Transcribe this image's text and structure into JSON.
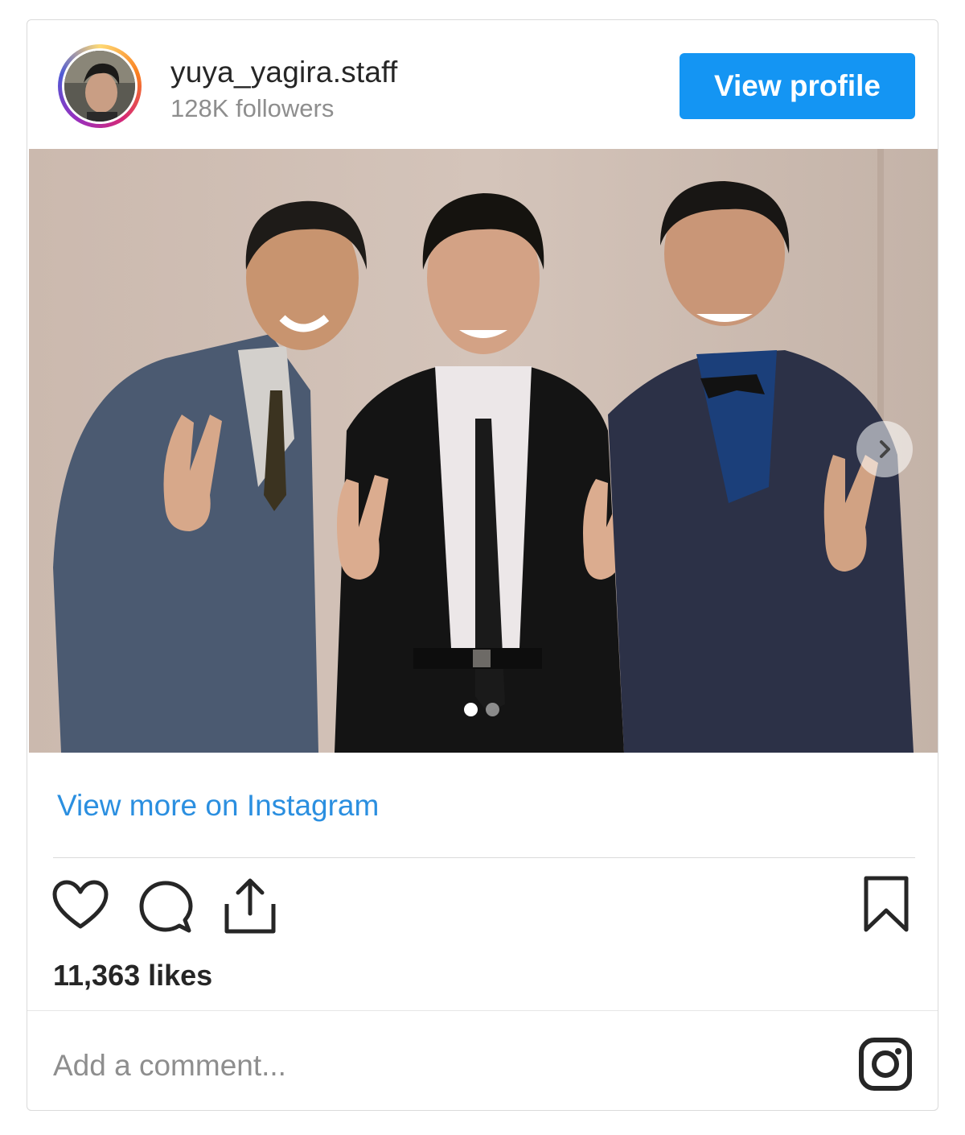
{
  "header": {
    "username": "yuya_yagira.staff",
    "followers": "128K followers",
    "view_profile_label": "View profile"
  },
  "post": {
    "carousel_slides": 2,
    "active_slide": 1
  },
  "links": {
    "view_more": "View more on Instagram"
  },
  "stats": {
    "likes": "11,363 likes"
  },
  "comment": {
    "placeholder": "Add a comment..."
  },
  "icons": [
    "heart-icon",
    "comment-icon",
    "share-icon",
    "bookmark-icon",
    "instagram-logo-icon",
    "chevron-right-icon"
  ],
  "colors": {
    "accent": "#1495f3",
    "link": "#2b8fe0",
    "text": "#262626",
    "muted": "#8e8e8e"
  }
}
